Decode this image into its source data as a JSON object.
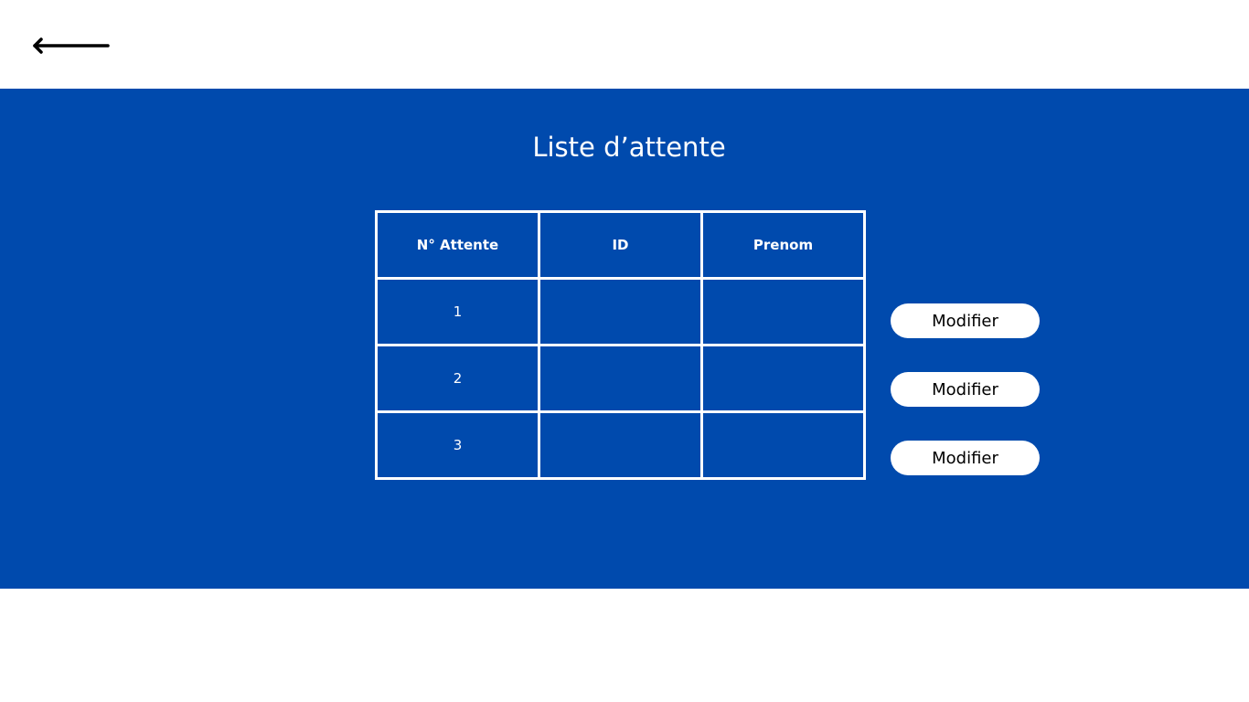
{
  "header": {
    "back_icon": "arrow-left-icon"
  },
  "main": {
    "title": "Liste d’attente",
    "table": {
      "headers": [
        "N° Attente",
        "ID",
        "Prenom"
      ],
      "rows": [
        [
          "1",
          "",
          ""
        ],
        [
          "2",
          "",
          ""
        ],
        [
          "3",
          "",
          ""
        ]
      ]
    },
    "actions": [
      {
        "label": "Modifier"
      },
      {
        "label": "Modifier"
      },
      {
        "label": "Modifier"
      }
    ]
  },
  "colors": {
    "panel_background": "#004aad",
    "text_on_panel": "#ffffff",
    "button_background": "#ffffff",
    "button_text": "#000000"
  }
}
